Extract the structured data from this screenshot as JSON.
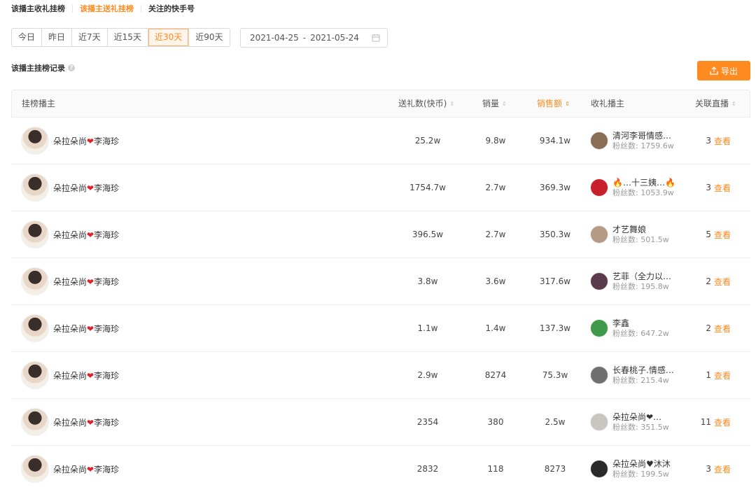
{
  "tabs": [
    {
      "label": "该播主收礼挂榜",
      "active": false
    },
    {
      "label": "该播主送礼挂榜",
      "active": true
    },
    {
      "label": "关注的快手号",
      "active": false
    }
  ],
  "ranges": [
    {
      "label": "今日",
      "active": false
    },
    {
      "label": "昨日",
      "active": false
    },
    {
      "label": "近7天",
      "active": false
    },
    {
      "label": "近15天",
      "active": false
    },
    {
      "label": "近30天",
      "active": true
    },
    {
      "label": "近90天",
      "active": false
    }
  ],
  "date_range": {
    "start": "2021-04-25",
    "sep": "-",
    "end": "2021-05-24"
  },
  "section_title": "该播主挂榜记录",
  "help_glyph": "?",
  "export_label": "导出",
  "columns": {
    "host": "挂榜播主",
    "gift": "送礼数(快币)",
    "sales": "销量",
    "revenue": "销售额",
    "receiver": "收礼播主",
    "live": "关联直播"
  },
  "view_label": "查看",
  "accent": "#ff8a1f",
  "rows": [
    {
      "host_a": "朵拉朵尚",
      "heart": "❤",
      "host_b": "李海珍",
      "gift": "25.2w",
      "sales": "9.8w",
      "revenue": "934.1w",
      "receiver": "清河李哥情感…",
      "fans": "粉丝数: 1759.6w",
      "live": "3",
      "avatar_color": "#8a6d55"
    },
    {
      "host_a": "朵拉朵尚",
      "heart": "❤",
      "host_b": "李海珍",
      "gift": "1754.7w",
      "sales": "2.7w",
      "revenue": "369.3w",
      "receiver": "🔥…十三姨…🔥",
      "fans": "粉丝数: 1053.9w",
      "live": "3",
      "avatar_color": "#c8202a"
    },
    {
      "host_a": "朵拉朵尚",
      "heart": "❤",
      "host_b": "李海珍",
      "gift": "396.5w",
      "sales": "2.7w",
      "revenue": "350.3w",
      "receiver": "才艺舞娘",
      "fans": "粉丝数: 501.5w",
      "live": "5",
      "avatar_color": "#b59a86"
    },
    {
      "host_a": "朵拉朵尚",
      "heart": "❤",
      "host_b": "李海珍",
      "gift": "3.8w",
      "sales": "3.6w",
      "revenue": "317.6w",
      "receiver": "艺菲（全力以…",
      "fans": "粉丝数: 195.8w",
      "live": "2",
      "avatar_color": "#5a3b4b"
    },
    {
      "host_a": "朵拉朵尚",
      "heart": "❤",
      "host_b": "李海珍",
      "gift": "1.1w",
      "sales": "1.4w",
      "revenue": "137.3w",
      "receiver": "李鑫",
      "fans": "粉丝数: 647.2w",
      "live": "2",
      "avatar_color": "#3f9a4a"
    },
    {
      "host_a": "朵拉朵尚",
      "heart": "❤",
      "host_b": "李海珍",
      "gift": "2.9w",
      "sales": "8274",
      "revenue": "75.3w",
      "receiver": "长春桃子.情感…",
      "fans": "粉丝数: 215.4w",
      "live": "1",
      "avatar_color": "#6f6f6f"
    },
    {
      "host_a": "朵拉朵尚",
      "heart": "❤",
      "host_b": "李海珍",
      "gift": "2354",
      "sales": "380",
      "revenue": "2.5w",
      "receiver": "朵拉朵尚❤…",
      "fans": "粉丝数: 351.5w",
      "live": "11",
      "avatar_color": "#c7c7c0"
    },
    {
      "host_a": "朵拉朵尚",
      "heart": "❤",
      "host_b": "李海珍",
      "gift": "2832",
      "sales": "118",
      "revenue": "8273",
      "receiver": "朵拉朵尚♥沐沐",
      "fans": "粉丝数: 199.5w",
      "live": "3",
      "avatar_color": "#2a2a2a"
    }
  ]
}
